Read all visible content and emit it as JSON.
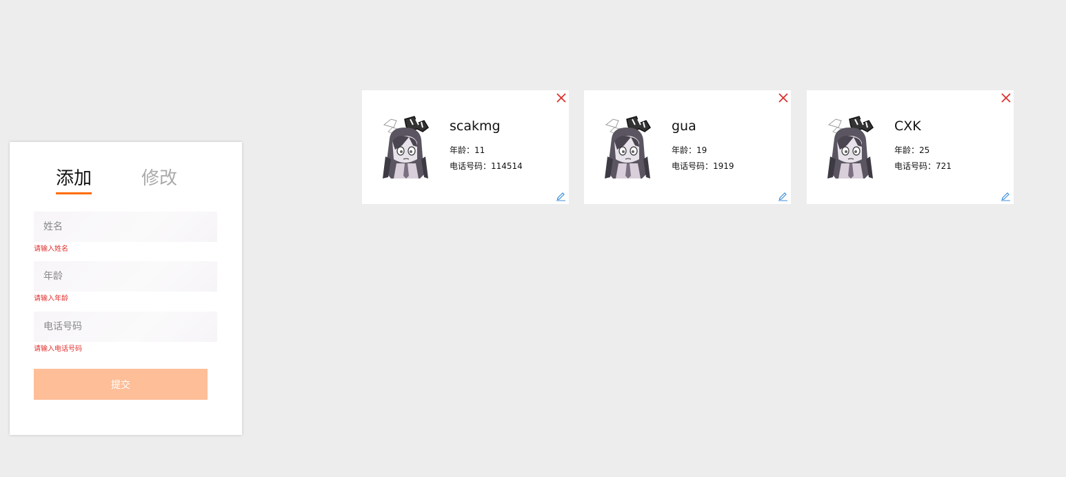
{
  "form": {
    "tabs": {
      "add": "添加",
      "edit": "修改"
    },
    "fields": {
      "name": {
        "placeholder": "姓名",
        "value": "",
        "error": "请输入姓名"
      },
      "age": {
        "placeholder": "年龄",
        "value": "",
        "error": "请输入年龄"
      },
      "phone": {
        "placeholder": "电话号码",
        "value": "",
        "error": "请输入电话号码"
      }
    },
    "submit_label": "提交"
  },
  "cards": [
    {
      "name": "scakmg",
      "age_text": "年龄：11",
      "phone_text": "电话号码：114514"
    },
    {
      "name": "gua",
      "age_text": "年龄：19",
      "phone_text": "电话号码：1919"
    },
    {
      "name": "CXK",
      "age_text": "年龄：25",
      "phone_text": "电话号码：721"
    }
  ],
  "colors": {
    "background": "#ededed",
    "accent": "#ff6a00",
    "submit": "#fdbe98",
    "error": "#e0312f",
    "close": "#d9302c",
    "edit": "#3c8dde"
  },
  "icons": {
    "close": "close-icon",
    "edit": "pencil-icon",
    "avatar": "avatar-image"
  }
}
